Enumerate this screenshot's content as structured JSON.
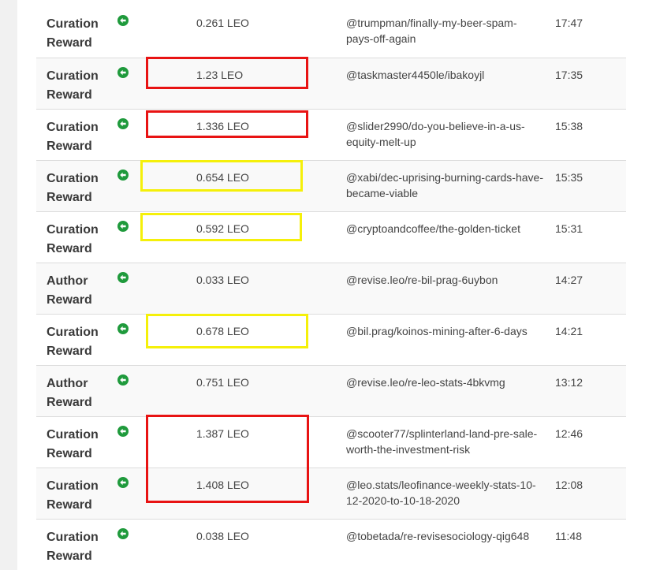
{
  "rows": [
    {
      "type_line1": "Curation",
      "type_line2": "Reward",
      "icon": "arrow-left-circle-icon",
      "amount": "0.261 LEO",
      "memo": "@trumpman/finally-my-beer-spam-pays-off-again",
      "time": "17:47"
    },
    {
      "type_line1": "Curation",
      "type_line2": "Reward",
      "icon": "arrow-left-circle-icon",
      "amount": "1.23 LEO",
      "memo": "@taskmaster4450le/ibakoyjl",
      "time": "17:35"
    },
    {
      "type_line1": "Curation",
      "type_line2": "Reward",
      "icon": "arrow-left-circle-icon",
      "amount": "1.336 LEO",
      "memo": "@slider2990/do-you-believe-in-a-us-equity-melt-up",
      "time": "15:38"
    },
    {
      "type_line1": "Curation",
      "type_line2": "Reward",
      "icon": "arrow-left-circle-icon",
      "amount": "0.654 LEO",
      "memo": "@xabi/dec-uprising-burning-cards-have-became-viable",
      "time": "15:35"
    },
    {
      "type_line1": "Curation",
      "type_line2": "Reward",
      "icon": "arrow-left-circle-icon",
      "amount": "0.592 LEO",
      "memo": "@cryptoandcoffee/the-golden-ticket",
      "time": "15:31"
    },
    {
      "type_line1": "Author",
      "type_line2": "Reward",
      "icon": "arrow-left-circle-icon",
      "amount": "0.033 LEO",
      "memo": "@revise.leo/re-bil-prag-6uybon",
      "time": "14:27"
    },
    {
      "type_line1": "Curation",
      "type_line2": "Reward",
      "icon": "arrow-left-circle-icon",
      "amount": "0.678 LEO",
      "memo": "@bil.prag/koinos-mining-after-6-days",
      "time": "14:21"
    },
    {
      "type_line1": "Author",
      "type_line2": "Reward",
      "icon": "arrow-left-circle-icon",
      "amount": "0.751 LEO",
      "memo": "@revise.leo/re-leo-stats-4bkvmg",
      "time": "13:12"
    },
    {
      "type_line1": "Curation",
      "type_line2": "Reward",
      "icon": "arrow-left-circle-icon",
      "amount": "1.387 LEO",
      "memo": "@scooter77/splinterland-land-pre-sale-worth-the-investment-risk",
      "time": "12:46"
    },
    {
      "type_line1": "Curation",
      "type_line2": "Reward",
      "icon": "arrow-left-circle-icon",
      "amount": "1.408 LEO",
      "memo": "@leo.stats/leofinance-weekly-stats-10-12-2020-to-10-18-2020",
      "time": "12:08"
    },
    {
      "type_line1": "Curation",
      "type_line2": "Reward",
      "icon": "arrow-left-circle-icon",
      "amount": "0.038 LEO",
      "memo": "@tobetada/re-revisesociology-qig648",
      "time": "11:48"
    }
  ],
  "colors": {
    "icon_green": "#1f9a3c",
    "highlight_red": "#e81313",
    "highlight_yellow": "#f5f00a"
  }
}
